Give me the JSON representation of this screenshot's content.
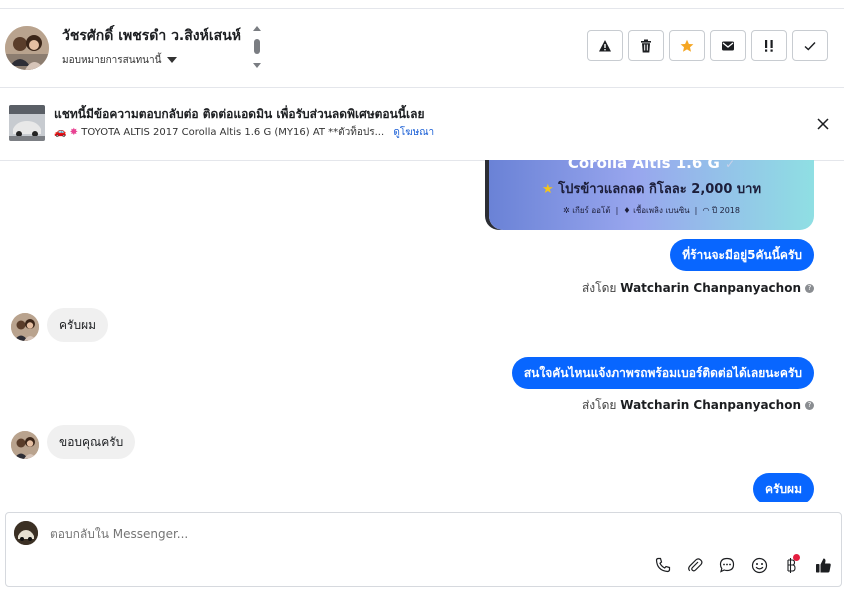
{
  "header": {
    "contact_name": "วัชรศักดิ์ เพชรดำ ว.สิงห์เสนห์",
    "assign_label": "มอบหมายการสนทนานี้"
  },
  "actions": [
    {
      "name": "report-spam-button",
      "icon": "warning-triangle-icon"
    },
    {
      "name": "delete-button",
      "icon": "trash-icon"
    },
    {
      "name": "star-button",
      "icon": "star-icon",
      "color": "#f5a623"
    },
    {
      "name": "mark-unread-button",
      "icon": "envelope-icon"
    },
    {
      "name": "follow-up-button",
      "icon": "exclamation-icon"
    },
    {
      "name": "mark-done-button",
      "icon": "check-icon"
    }
  ],
  "ad": {
    "title": "แชทนี้มีข้อความตอบกลับต่อ ติดต่อแอดมิน เพื่อรับส่วนลดพิเศษตอนนี้เลย",
    "subtitle": "TOYOTA ALTIS 2017 Corolla Altis 1.6 G (MY16) AT **ตัวท็อปร...",
    "link": "ดูโฆษณา"
  },
  "card": {
    "title": "Corolla Altis 1.6 G",
    "promo": "โปรข้าวแลกลด กิโลละ 2,000 บาท",
    "gear": "เกียร์ ออโต้",
    "fuel": "เชื้อเพลิง เบนซิน",
    "year": "ปี 2018"
  },
  "messages": [
    {
      "dir": "out",
      "text": "ที่ร้านจะมีอยู่5คันนี้ครับ"
    },
    {
      "dir": "meta",
      "prefix": "ส่งโดย",
      "sender": "Watcharin Chanpanyachon"
    },
    {
      "dir": "in",
      "text": "ครับผม"
    },
    {
      "dir": "out",
      "text": "สนใจคันไหนแจ้งภาพรถพร้อมเบอร์ติดต่อได้เลยนะครับ"
    },
    {
      "dir": "meta",
      "prefix": "ส่งโดย",
      "sender": "Watcharin Chanpanyachon"
    },
    {
      "dir": "in",
      "text": "ขอบคุณครับ"
    },
    {
      "dir": "out",
      "text": "ครับผม"
    }
  ],
  "composer": {
    "placeholder": "ตอบกลับใน Messenger...",
    "tools": [
      "phone-icon",
      "attachment-icon",
      "saved-reply-icon",
      "emoji-icon",
      "baht-icon",
      "thumbs-up-icon"
    ]
  },
  "colors": {
    "primary_blue": "#0866ff",
    "incoming_bubble": "#f0f0f0",
    "star": "#f5a623",
    "notification_dot": "#e41e3f"
  }
}
